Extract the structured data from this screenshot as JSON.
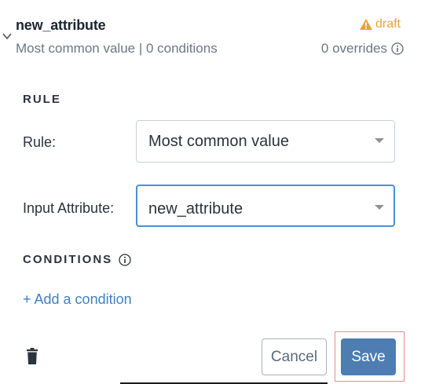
{
  "attribute": {
    "name": "new_attribute",
    "summary": "Most common value | 0 conditions",
    "status": "draft",
    "overrides": "0 overrides"
  },
  "rule_section": {
    "title": "RULE",
    "rule_label": "Rule:",
    "rule_value": "Most common value",
    "input_label": "Input Attribute:",
    "input_value": "new_attribute"
  },
  "conditions_section": {
    "title": "CONDITIONS",
    "add_label": "+ Add a condition"
  },
  "footer": {
    "cancel_label": "Cancel",
    "save_label": "Save"
  },
  "colors": {
    "warning": "#e7a23a",
    "link": "#3f7fc2",
    "primary": "#4d7db1",
    "focus": "#4b8fd6"
  }
}
